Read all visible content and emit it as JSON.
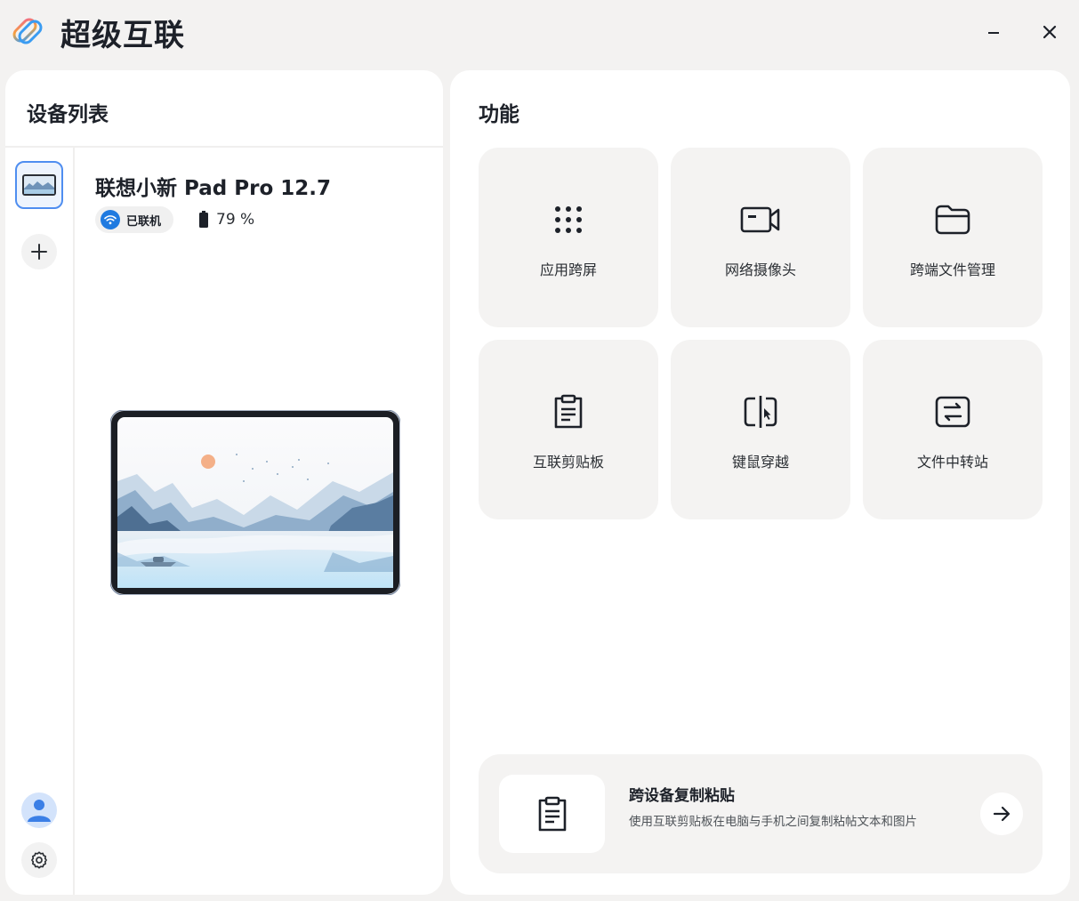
{
  "app": {
    "title": "超级互联",
    "logo_icon": "super-connect-logo",
    "colors": {
      "accent": "#1f7ae0",
      "selected_border": "#4f8ef0",
      "card_bg": "#f4f3f2",
      "window_bg": "#f3f2f1"
    }
  },
  "window_controls": {
    "minimize_icon": "minimize-icon",
    "close_icon": "close-icon"
  },
  "device_panel": {
    "title": "设备列表",
    "device": {
      "name": "联想小新 Pad Pro 12.7",
      "status": "已联机",
      "status_icon": "wifi-icon",
      "battery": "79 %",
      "battery_icon": "battery-icon"
    },
    "add_icon": "plus-icon",
    "avatar_icon": "user-avatar-icon",
    "settings_icon": "gear-icon"
  },
  "feature_panel": {
    "title": "功能",
    "features": [
      {
        "label": "应用跨屏",
        "icon": "app-grid-icon"
      },
      {
        "label": "网络摄像头",
        "icon": "camera-icon"
      },
      {
        "label": "跨端文件管理",
        "icon": "folder-icon"
      },
      {
        "label": "互联剪贴板",
        "icon": "clipboard-icon"
      },
      {
        "label": "键鼠穿越",
        "icon": "keyboard-mouse-cross-icon"
      },
      {
        "label": "文件中转站",
        "icon": "file-transfer-icon"
      }
    ],
    "promo": {
      "title": "跨设备复制粘贴",
      "description": "使用互联剪贴板在电脑与手机之间复制粘帖文本和图片",
      "icon": "clipboard-icon",
      "action_icon": "arrow-right-icon"
    }
  }
}
